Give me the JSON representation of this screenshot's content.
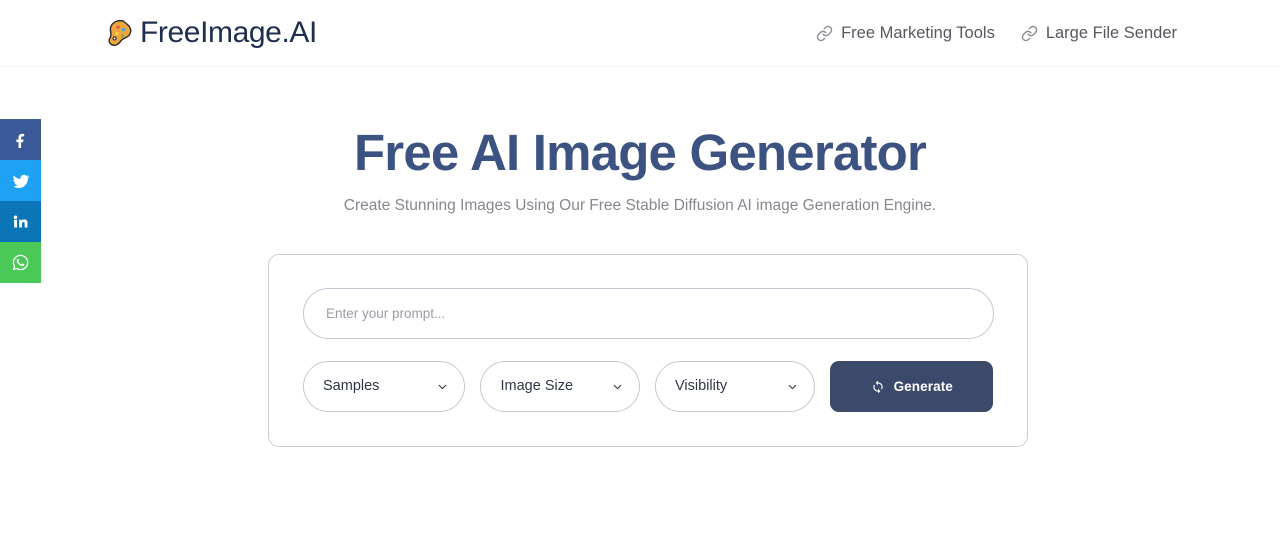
{
  "header": {
    "brand": {
      "icon": "palette-icon",
      "name": "FreeImage.AI"
    },
    "nav": [
      {
        "icon": "link-icon",
        "label": "Free Marketing Tools"
      },
      {
        "icon": "link-icon",
        "label": "Large File Sender"
      }
    ]
  },
  "social_rail": [
    {
      "name": "facebook",
      "icon": "facebook-icon",
      "color": "#3b5998"
    },
    {
      "name": "twitter",
      "icon": "twitter-icon",
      "color": "#1da1f2"
    },
    {
      "name": "linkedin",
      "icon": "linkedin-icon",
      "color": "#0b76b7"
    },
    {
      "name": "whatsapp",
      "icon": "whatsapp-icon",
      "color": "#4ac959"
    }
  ],
  "hero": {
    "title": "Free AI Image Generator",
    "subtitle": "Create Stunning Images Using Our Free Stable Diffusion AI image Generation Engine.",
    "title_color": "#3c5280",
    "subtitle_color": "#84888e"
  },
  "generator": {
    "prompt": {
      "placeholder": "Enter your prompt...",
      "value": ""
    },
    "samples": {
      "label": "Samples",
      "selected": "Samples",
      "options": [
        "Samples"
      ]
    },
    "image_size": {
      "label": "Image Size",
      "selected": "Image Size",
      "options": [
        "Image Size"
      ]
    },
    "visibility": {
      "label": "Visibility",
      "selected": "Visibility",
      "options": [
        "Visibility"
      ]
    },
    "generate_button": {
      "label": "Generate",
      "icon": "sync-icon",
      "color": "#3b4a6b"
    }
  }
}
